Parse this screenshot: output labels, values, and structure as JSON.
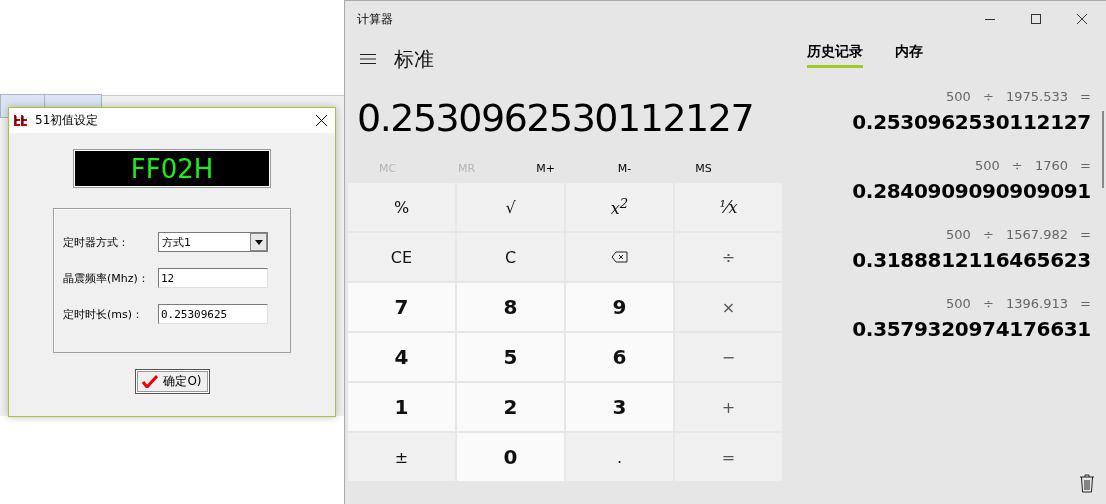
{
  "dialog": {
    "title": "51初值设定",
    "display": "FF02H",
    "fields": [
      {
        "kind": "select",
        "label": "定时器方式：",
        "value": "方式1"
      },
      {
        "kind": "input",
        "label": "晶震频率(Mhz)：",
        "value": "12"
      },
      {
        "kind": "input",
        "label": "定时时长(ms)：",
        "value": "0.25309625"
      }
    ],
    "button": "确定O)"
  },
  "calculator": {
    "title": "计算器",
    "mode": "标准",
    "display": "0.2530962530112127",
    "memory": [
      {
        "label": "MC",
        "disabled": true
      },
      {
        "label": "MR",
        "disabled": true
      },
      {
        "label": "M+",
        "disabled": false
      },
      {
        "label": "M-",
        "disabled": false
      },
      {
        "label": "MS",
        "disabled": false
      }
    ],
    "keys": [
      {
        "kind": "function",
        "label": "%"
      },
      {
        "kind": "function",
        "label": "√"
      },
      {
        "kind": "function",
        "label": "*x*$^{2}$"
      },
      {
        "kind": "function",
        "label": "⅟x"
      },
      {
        "kind": "function",
        "label": "CE"
      },
      {
        "kind": "function",
        "label": "C"
      },
      {
        "kind": "backspace"
      },
      {
        "kind": "operator",
        "label": "÷"
      },
      {
        "kind": "digit",
        "label": "7"
      },
      {
        "kind": "digit",
        "label": "8"
      },
      {
        "kind": "digit",
        "label": "9"
      },
      {
        "kind": "operator",
        "label": "×"
      },
      {
        "kind": "digit",
        "label": "4"
      },
      {
        "kind": "digit",
        "label": "5"
      },
      {
        "kind": "digit",
        "label": "6"
      },
      {
        "kind": "operator",
        "label": "−"
      },
      {
        "kind": "digit",
        "label": "1"
      },
      {
        "kind": "digit",
        "label": "2"
      },
      {
        "kind": "digit",
        "label": "3"
      },
      {
        "kind": "operator",
        "label": "+"
      },
      {
        "kind": "function",
        "label": "±"
      },
      {
        "kind": "digit",
        "label": "0"
      },
      {
        "kind": "function",
        "label": "."
      },
      {
        "kind": "operator",
        "label": "="
      }
    ],
    "tabs": [
      {
        "label": "历史记录",
        "selected": true
      },
      {
        "label": "内存",
        "selected": false
      }
    ],
    "history": [
      {
        "expression": "500 ÷ 1975.533 =",
        "result": "0.2530962530112127"
      },
      {
        "expression": "500 ÷ 1760 =",
        "result": "0.2840909090909091"
      },
      {
        "expression": "500 ÷ 1567.982 =",
        "result": "0.3188812116465623"
      },
      {
        "expression": "500 ÷ 1396.913 =",
        "result": "0.3579320974176631"
      }
    ]
  }
}
